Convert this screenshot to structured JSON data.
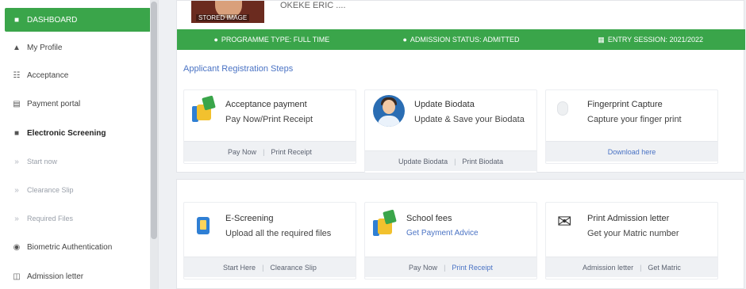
{
  "sidebar": {
    "items": [
      {
        "label": "DASHBOARD",
        "icon": "dashboard-icon",
        "glyph": "■"
      },
      {
        "label": "My Profile",
        "icon": "user-icon",
        "glyph": "▲"
      },
      {
        "label": "Acceptance",
        "icon": "list-icon",
        "glyph": "☷"
      },
      {
        "label": "Payment portal",
        "icon": "card-icon",
        "glyph": "▤"
      },
      {
        "label": "Electronic Screening",
        "icon": "monitor-icon",
        "glyph": "■"
      },
      {
        "label": "Start now",
        "icon": "arrow-icon",
        "glyph": "»"
      },
      {
        "label": "Clearance Slip",
        "icon": "arrow-icon",
        "glyph": "»"
      },
      {
        "label": "Required Files",
        "icon": "arrow-icon",
        "glyph": "»"
      },
      {
        "label": "Biometric Authentication",
        "icon": "fingerprint-icon",
        "glyph": "◉"
      },
      {
        "label": "Admission letter",
        "icon": "letter-icon",
        "glyph": "◫"
      }
    ]
  },
  "profile": {
    "photo_label": "STORED IMAGE",
    "name_text": "OKEKE ERIC ...."
  },
  "status_bar": {
    "programme_type": "PROGRAMME TYPE: FULL TIME",
    "admission_status": "ADMISSION STATUS: ADMITTED",
    "entry_session": "ENTRY SESSION: 2021/2022"
  },
  "steps_title": "Applicant Registration Steps",
  "cards": {
    "acceptance": {
      "title": "Acceptance payment",
      "desc": "Pay Now/Print Receipt",
      "action1": "Pay Now",
      "action2": "Print Receipt"
    },
    "biodata": {
      "title": "Update Biodata",
      "desc": "Update & Save your Biodata",
      "action1": "Update Biodata",
      "action2": "Print Biodata"
    },
    "fingerprint": {
      "title": "Fingerprint Capture",
      "desc": "Capture your finger print",
      "action1": "Download here"
    },
    "escreening": {
      "title": "E-Screening",
      "desc": "Upload all the required files",
      "action1": "Start Here",
      "action2": "Clearance Slip"
    },
    "school_fees": {
      "title": "School fees",
      "desc": "Get Payment Advice",
      "action1": "Pay Now",
      "action2": "Print Receipt"
    },
    "admission_letter": {
      "title": "Print Admission letter",
      "desc": "Get your Matric number",
      "action1": "Admission letter",
      "action2": "Get Matric"
    }
  },
  "separator": "|",
  "colors": {
    "accent_green": "#3aa54a",
    "link_blue": "#4a73c4"
  }
}
